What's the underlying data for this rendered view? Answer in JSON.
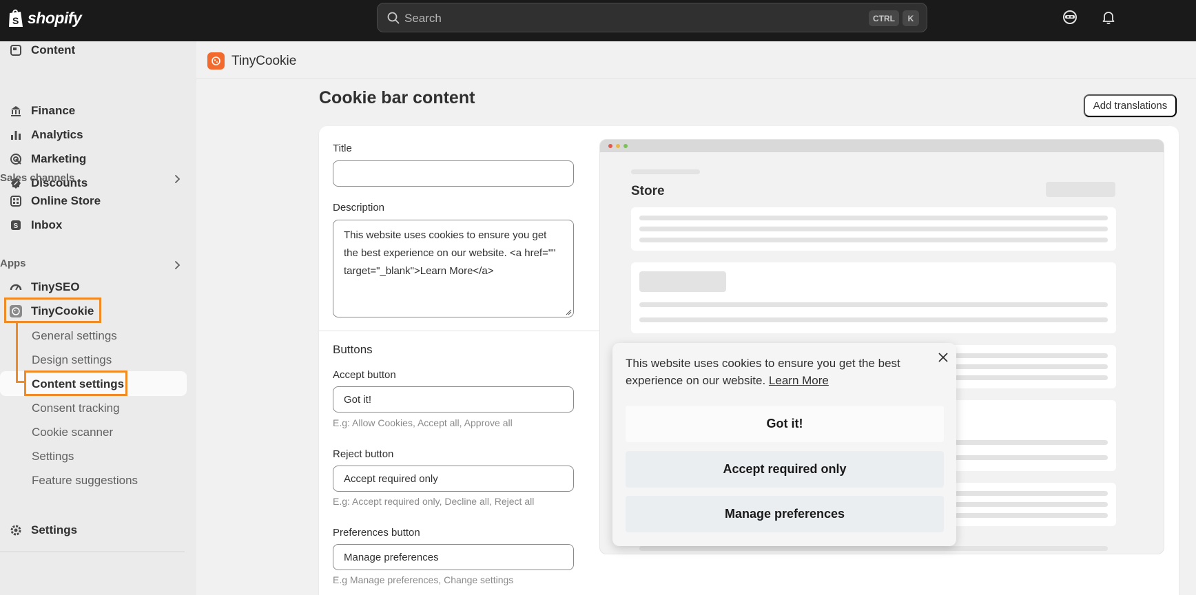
{
  "topbar": {
    "brand": "shopify",
    "search_placeholder": "Search",
    "shortcut_ctrl": "CTRL",
    "shortcut_key": "K"
  },
  "sidebar": {
    "items_top": [
      {
        "label": "Content",
        "icon": "content-icon"
      },
      {
        "label": "Finance",
        "icon": "bank-icon"
      },
      {
        "label": "Analytics",
        "icon": "bar-chart-icon"
      },
      {
        "label": "Marketing",
        "icon": "target-icon"
      },
      {
        "label": "Discounts",
        "icon": "discount-icon"
      }
    ],
    "sales_channels_label": "Sales channels",
    "sales_channels": [
      {
        "label": "Online Store",
        "icon": "store-icon"
      },
      {
        "label": "Inbox",
        "icon": "inbox-icon"
      }
    ],
    "apps_label": "Apps",
    "apps": [
      {
        "label": "TinySEO",
        "icon": "gauge-icon"
      },
      {
        "label": "TinyCookie",
        "icon": "cookie-app-icon"
      }
    ],
    "tinycookie_sub": [
      "General settings",
      "Design settings",
      "Content settings",
      "Consent tracking",
      "Cookie scanner",
      "Settings",
      "Feature suggestions"
    ],
    "settings_label": "Settings"
  },
  "app_header": {
    "name": "TinyCookie"
  },
  "page": {
    "title": "Cookie bar content",
    "add_translations": "Add translations"
  },
  "form": {
    "title_label": "Title",
    "title_value": "",
    "description_label": "Description",
    "description_value": "This website uses cookies to ensure you get the best experience on our website. <a href=\"\" target=\"_blank\">Learn More</a>",
    "buttons_heading": "Buttons",
    "accept_label": "Accept button",
    "accept_value": "Got it!",
    "accept_hint": "E.g: Allow Cookies, Accept all, Approve all",
    "reject_label": "Reject button",
    "reject_value": "Accept required only",
    "reject_hint": "E.g: Accept required only, Decline all, Reject all",
    "prefs_label": "Preferences button",
    "prefs_value": "Manage preferences",
    "prefs_hint": "E.g Manage preferences, Change settings"
  },
  "preview": {
    "store_label": "Store",
    "cookie_text": "This website uses cookies to ensure you get the best experience on our website.",
    "cookie_link": "Learn More",
    "accept_btn": "Got it!",
    "reject_btn": "Accept required only",
    "prefs_btn": "Manage preferences"
  },
  "colors": {
    "accent_highlight": "#f08a24",
    "app_brand": "#f26a2e",
    "topbar": "#1a1a1a"
  }
}
